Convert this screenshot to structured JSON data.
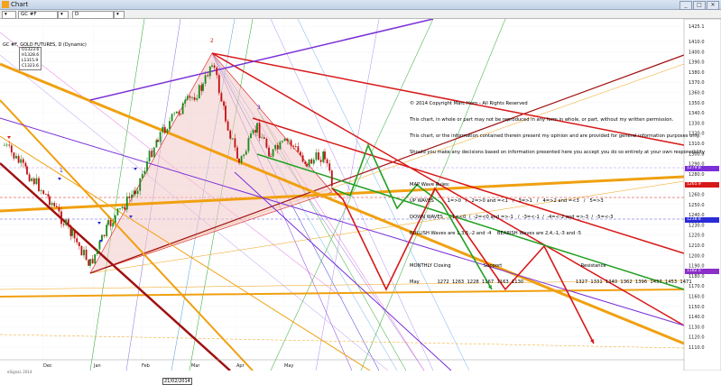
{
  "window": {
    "title": "Chart",
    "buttons": [
      "_",
      "□",
      "✕"
    ]
  },
  "toolbar": {
    "symbol_value": "GC #F",
    "interval_value": "D"
  },
  "chart": {
    "symbol_label": "GC #F, GOLD FUTURES, D (Dynamic)",
    "ohlc": [
      "O1323.6",
      "H1328.6",
      "L1315.9",
      "C1323.6"
    ],
    "wave_marks": [
      "2",
      "3",
      "1"
    ],
    "x_labels": [
      "Dec",
      "Jan",
      "Feb",
      "Mar",
      "Apr",
      "May"
    ],
    "date_readout": "21/02/2014",
    "esignal": "eSignal, 2014",
    "y_labels": [
      "1425.1",
      "1410.0",
      "1400.0",
      "1390.0",
      "1380.0",
      "1370.0",
      "1360.0",
      "1350.0",
      "1340.0",
      "1330.0",
      "1320.0",
      "1310.0",
      "1300.0",
      "1290.0",
      "1280.0",
      "1270.0",
      "1260.0",
      "1250.0",
      "1240.0",
      "1230.0",
      "1220.0",
      "1210.0",
      "1200.0",
      "1190.0",
      "1180.0",
      "1170.0",
      "1160.0",
      "1150.0",
      "1140.0",
      "1130.0",
      "1120.0",
      "1110.0"
    ],
    "price_tags": [
      {
        "label": "1279.8",
        "color": "#7a2fd8"
      },
      {
        "label": "1265.9",
        "color": "#d81818"
      },
      {
        "label": "1238.8",
        "color": "#2b2bd8"
      },
      {
        "label": "1182.5",
        "color": "#8a2fc8"
      }
    ],
    "colors": {
      "red": "#d81818",
      "darkred": "#a01010",
      "orange": "#f0a010",
      "green": "#22a022",
      "purple": "#7a2fd8"
    }
  },
  "info": {
    "lines": [
      "© 2014 Copyright Marc Horn - All Rights Reserved",
      "This chart, in whole or part may not be reproduced in any form in whole, or part, without my written permission.",
      "This chart, or the information contained therein present my opinion and are provided for general information purposes only.",
      "Should you make any decisions based on information presented here you accept you do so entirely at your own responsibility",
      "",
      "MAP Wave Rules:",
      "UP WAVES         1=>0   /   2=>0 and =<1   /   3=>1   /   4=>2 and =<3   /   5=>3",
      "DOWN WAVES     -1=<0  /  -2=<0 and =>-1   /  -3=<-1  /  -4=<-2 and =>-3  /  -5=<-3",
      "BULLISH Waves are 1,3,5,-2 and -4    BEARISH Waves are 2,4,-1,-3 and -5",
      "",
      "MONTHLY Closing                      Support                                                     Resistance",
      "May            1272  1263  1228  1167  1163  1130                                   1327  1331  1340  1362  1396  1437  1453  1471"
    ]
  }
}
